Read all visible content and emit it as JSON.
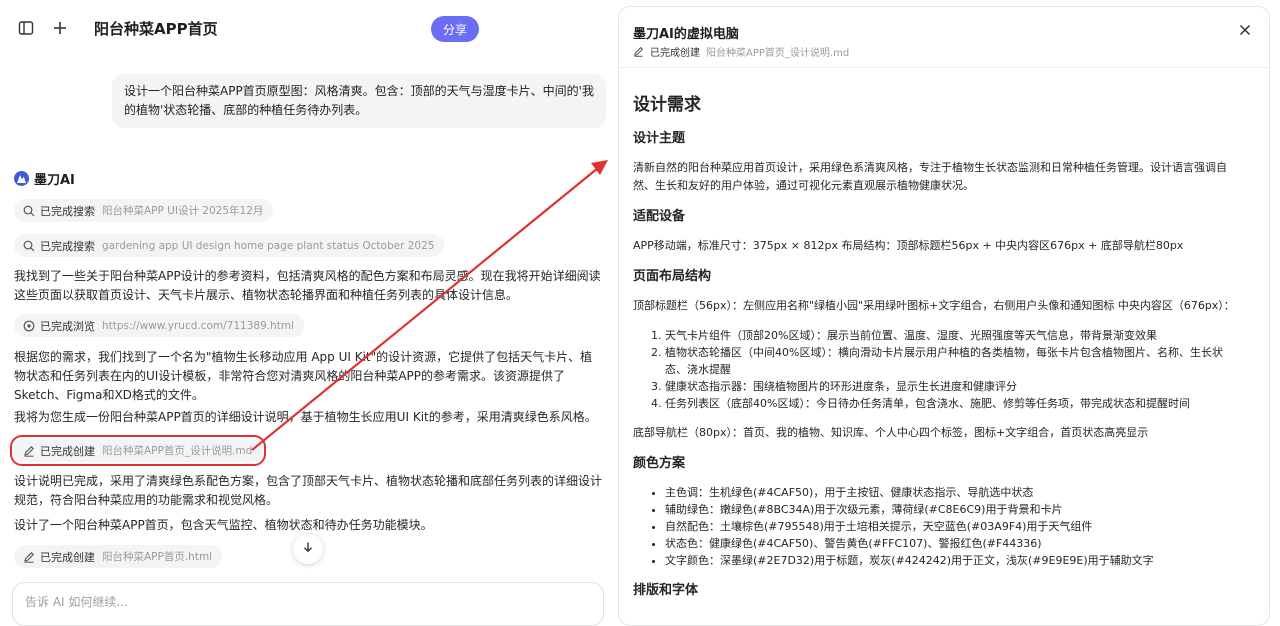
{
  "header": {
    "title": "阳台种菜APP首页",
    "share_label": "分享"
  },
  "conversation": {
    "user_message": "设计一个阳台种菜APP首页原型图：风格清爽。包含：顶部的天气与湿度卡片、中间的'我的植物'状态轮播、底部的种植任务待办列表。",
    "assistant_name": "墨刀AI",
    "chips": [
      {
        "status": "已完成搜索",
        "detail": "阳台种菜APP UI设计 2025年12月",
        "icon": "search-icon"
      },
      {
        "status": "已完成搜索",
        "detail": "gardening app UI design home page plant status October 2025",
        "icon": "search-icon"
      },
      {
        "status": "已完成浏览",
        "detail": "https://www.yrucd.com/711389.html",
        "icon": "browse-icon"
      },
      {
        "status": "已完成创建",
        "detail": "阳台种菜APP首页_设计说明.md",
        "icon": "edit-icon"
      },
      {
        "status": "已完成创建",
        "detail": "阳台种菜APP首页.html",
        "icon": "edit-icon"
      }
    ],
    "paragraphs": [
      "我找到了一些关于阳台种菜APP设计的参考资料，包括清爽风格的配色方案和布局灵感。现在我将开始详细阅读这些页面以获取首页设计、天气卡片展示、植物状态轮播界面和种植任务列表的具体设计信息。",
      "根据您的需求，我们找到了一个名为\"植物生长移动应用 App UI Kit\"的设计资源，它提供了包括天气卡片、植物状态和任务列表在内的UI设计模板，非常符合您对清爽风格的阳台种菜APP的参考需求。该资源提供了Sketch、Figma和XD格式的文件。",
      "我将为您生成一份阳台种菜APP首页的详细设计说明，基于植物生长应用UI Kit的参考，采用清爽绿色系风格。",
      "设计说明已完成，采用了清爽绿色系配色方案，包含了顶部天气卡片、植物状态轮播和底部任务列表的详细设计规范，符合阳台种菜应用的功能需求和视觉风格。",
      "设计了一个阳台种菜APP首页，包含天气监控、植物状态和待办任务功能模块。"
    ],
    "input_placeholder": "告诉 AI 如何继续..."
  },
  "panel": {
    "title": "墨刀AI的虚拟电脑",
    "status": "已完成创建",
    "file": "阳台种菜APP首页_设计说明.md",
    "doc": {
      "h1": "设计需求",
      "theme_heading": "设计主题",
      "theme_text": "清新自然的阳台种菜应用首页设计，采用绿色系清爽风格，专注于植物生长状态监测和日常种植任务管理。设计语言强调自然、生长和友好的用户体验，通过可视化元素直观展示植物健康状况。",
      "device_heading": "适配设备",
      "device_text": "APP移动端，标准尺寸：375px × 812px 布局结构：顶部标题栏56px + 中央内容区676px + 底部导航栏80px",
      "layout_heading": "页面布局结构",
      "layout_intro": "顶部标题栏（56px）：左侧应用名称\"绿植小园\"采用绿叶图标+文字组合，右侧用户头像和通知图标 中央内容区（676px）：",
      "layout_items": [
        "天气卡片组件（顶部20%区域）：展示当前位置、温度、湿度、光照强度等天气信息，带背景渐变效果",
        "植物状态轮播区（中间40%区域）：横向滑动卡片展示用户种植的各类植物，每张卡片包含植物图片、名称、生长状态、浇水提醒",
        "健康状态指示器：围绕植物图片的环形进度条，显示生长进度和健康评分",
        "任务列表区（底部40%区域）：今日待办任务清单，包含浇水、施肥、修剪等任务项，带完成状态和提醒时间"
      ],
      "bottom_nav_text": "底部导航栏（80px）：首页、我的植物、知识库、个人中心四个标签，图标+文字组合，首页状态高亮显示",
      "color_heading": "颜色方案",
      "color_items": [
        "主色调：生机绿色(#4CAF50)，用于主按钮、健康状态指示、导航选中状态",
        "辅助绿色：嫩绿色(#8BC34A)用于次级元素，薄荷绿(#C8E6C9)用于背景和卡片",
        "自然配色：土壤棕色(#795548)用于土培相关提示，天空蓝色(#03A9F4)用于天气组件",
        "状态色：健康绿色(#4CAF50)、警告黄色(#FFC107)、警报红色(#F44336)",
        "文字颜色：深墨绿(#2E7D32)用于标题，炭灰(#424242)用于正文，浅灰(#9E9E9E)用于辅助文字"
      ],
      "next_heading": "排版和字体"
    }
  },
  "colors": {
    "accent": "#6b6ef4",
    "highlight": "#e03131",
    "brand": "#3b5bdb"
  }
}
